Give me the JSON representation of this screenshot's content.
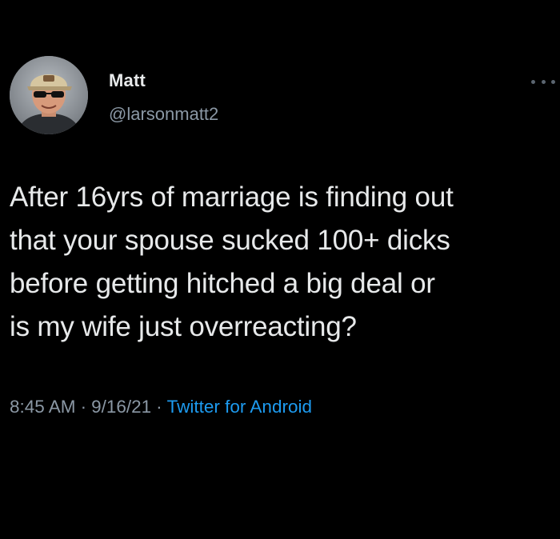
{
  "tweet": {
    "author": {
      "name": "Matt",
      "handle": "@larsonmatt2",
      "avatar": "profile-photo"
    },
    "more_icon": "ellipsis-icon",
    "text_lines": [
      "After 16yrs of marriage is finding out",
      "that your spouse sucked 100+ dicks",
      "before getting hitched a big deal or",
      "is my wife just overreacting?"
    ],
    "time": "8:45 AM",
    "date": "9/16/21",
    "separator": "·",
    "source": "Twitter for Android"
  },
  "colors": {
    "background": "#000000",
    "text": "#e7e9ea",
    "secondary": "#8b98a5",
    "link": "#1d9bf0"
  }
}
